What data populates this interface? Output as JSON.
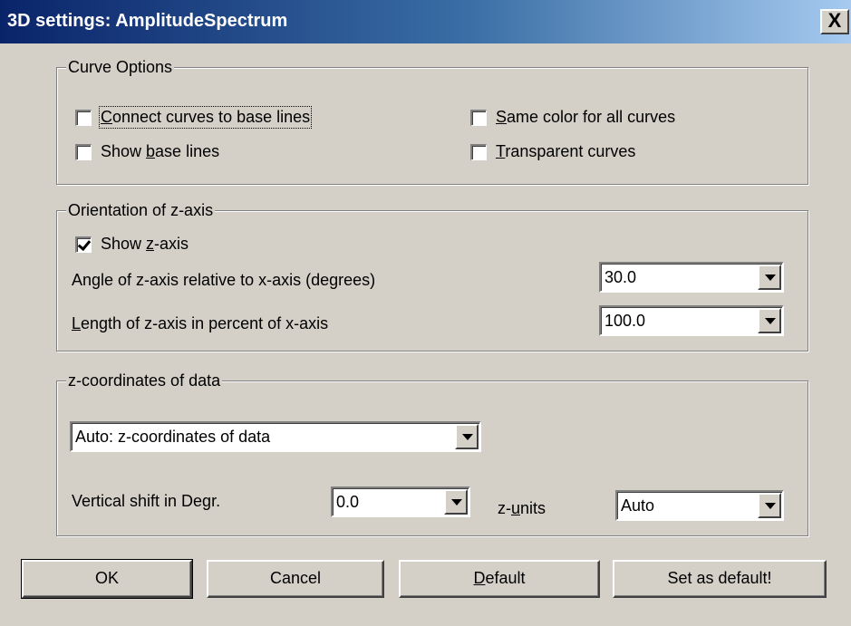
{
  "window": {
    "title": "3D settings: AmplitudeSpectrum",
    "close_glyph": "X"
  },
  "curve_options": {
    "legend": "Curve Options",
    "connect_curves": {
      "pre": "",
      "key": "C",
      "post": "onnect curves to base lines",
      "checked": false
    },
    "show_base_lines": {
      "pre": "Show ",
      "key": "b",
      "post": "ase lines",
      "checked": false
    },
    "same_color": {
      "pre": "",
      "key": "S",
      "post": "ame color for all curves",
      "checked": false
    },
    "transparent": {
      "pre": "",
      "key": "T",
      "post": "ransparent curves",
      "checked": false
    }
  },
  "orientation": {
    "legend": "Orientation of z-axis",
    "show_z_axis": {
      "pre": "Show ",
      "key": "z",
      "post": "-axis",
      "checked": true
    },
    "angle_label": "Angle of z-axis relative to x-axis (degrees)",
    "angle_value": "30.0",
    "length_label": {
      "pre": "",
      "key": "L",
      "post": "ength of z-axis in percent of x-axis"
    },
    "length_value": "100.0"
  },
  "zcoords": {
    "legend": "z-coordinates of data",
    "mode_value": "Auto: z-coordinates of data",
    "vshift_label": "Vertical shift in Degr.",
    "vshift_value": "0.0",
    "zunits_label": {
      "pre": "z-",
      "key": "u",
      "post": "nits"
    },
    "zunits_value": "Auto"
  },
  "buttons": {
    "ok": "OK",
    "cancel": "Cancel",
    "default": {
      "pre": "",
      "key": "D",
      "post": "efault"
    },
    "set_default": "Set as default!"
  }
}
